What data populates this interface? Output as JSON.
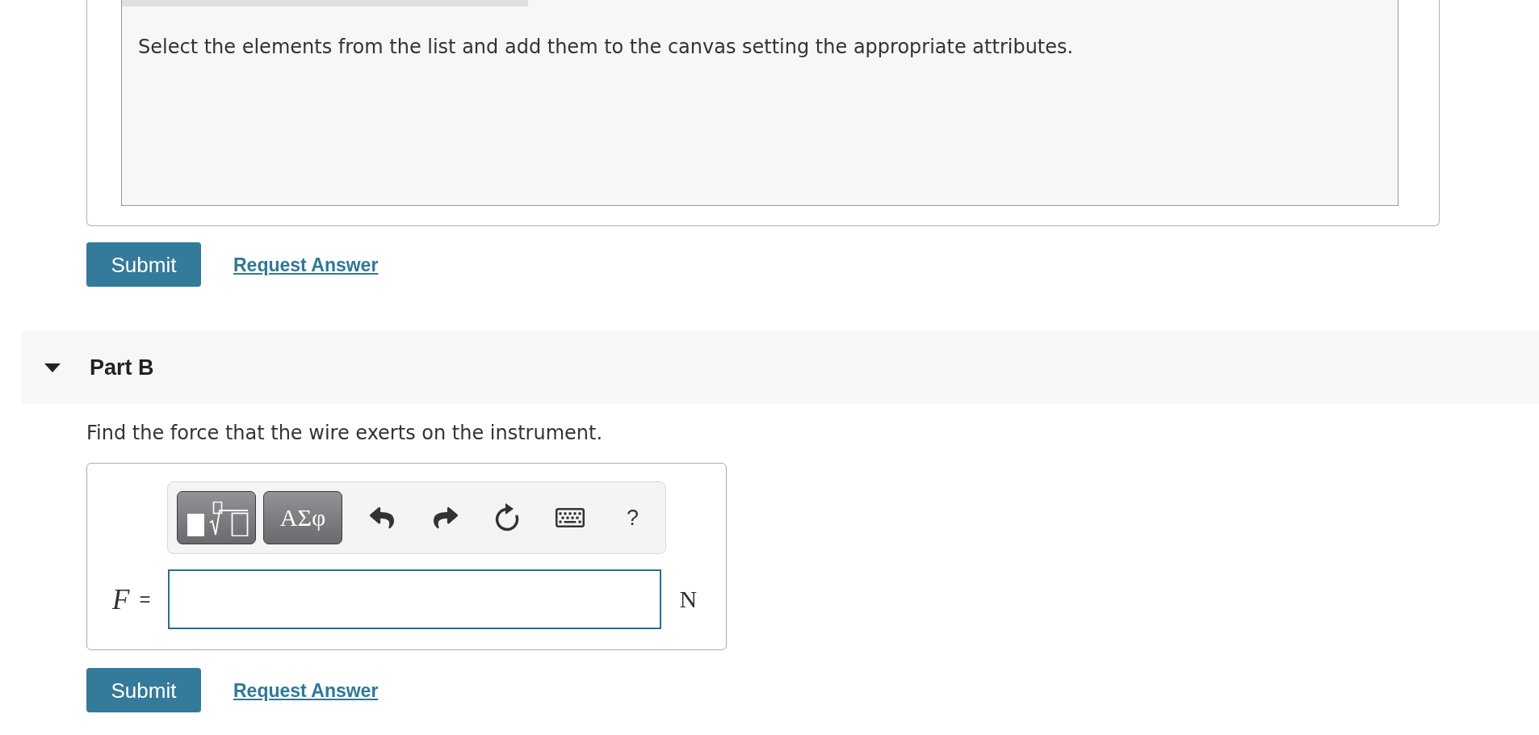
{
  "part_a": {
    "instructions": "Select the elements from the list and add them to the canvas setting the appropriate attributes.",
    "actions": {
      "submit": "Submit",
      "request_answer": "Request Answer"
    }
  },
  "part_b": {
    "title": "Part B",
    "expanded": true,
    "question": "Find the force that the wire exerts on the instrument.",
    "toolbar": [
      {
        "kind": "templates"
      },
      {
        "kind": "symbols",
        "label": "ΑΣφ"
      },
      {
        "kind": "undo"
      },
      {
        "kind": "redo"
      },
      {
        "kind": "reset"
      },
      {
        "kind": "keyboard"
      },
      {
        "kind": "help",
        "label": "?"
      }
    ],
    "answer": {
      "variable": "F",
      "equals": "=",
      "unit": "N"
    },
    "actions": {
      "submit": "Submit",
      "request_answer": "Request Answer"
    }
  }
}
